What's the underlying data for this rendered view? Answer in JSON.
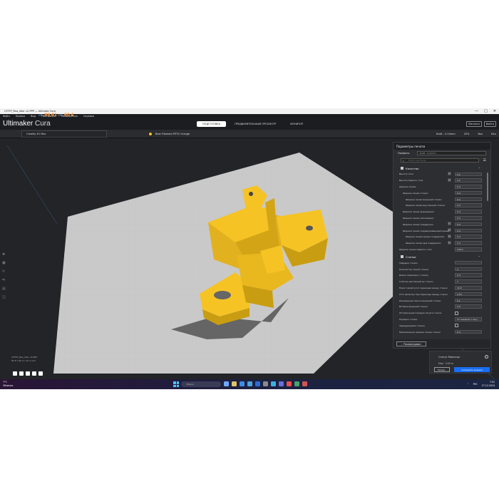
{
  "window": {
    "title": "CFFFP_Paw_Idler v2-PPP — Ultimate Cura",
    "controls": [
      "—",
      "□",
      "✕"
    ]
  },
  "menu": [
    "Файл",
    "Правка",
    "Вид",
    "Настройки",
    "Расширения",
    "Справка"
  ],
  "overlay_stats": {
    "label_a": "CPU",
    "val_a": "88",
    "sub_a": "41",
    "label_b": "GPU",
    "val_b": "60",
    "sub_b": "4"
  },
  "header": {
    "brand_bold": "Ultimaker",
    "brand_light": " Cura",
    "stage_tabs": [
      {
        "label": "ПОДГОТОВКА",
        "active": true
      },
      {
        "label": "ПРЕДВАРИТЕЛЬНЫЙ ПРОСМОТР",
        "active": false
      },
      {
        "label": "МОНИТОР",
        "active": false
      }
    ],
    "account_buttons": [
      "Магазин",
      "Войти"
    ]
  },
  "toolbar": {
    "printer": "Creality K1 Max",
    "material": "Best Filament PETG Orange",
    "profile_summary": "Draft - 0.24mm",
    "infill": "20%",
    "support": "Вкл",
    "adhesion": "Вкл"
  },
  "panel": {
    "title": "Параметры печати",
    "profile_label": "Профиль",
    "profile_value": "Draft - 0.24mm",
    "search_placeholder": "Поиск настроек",
    "category_quality": "Качество",
    "category_walls": "Стенки",
    "recommended_button": "Рекомендован",
    "quality_settings": [
      {
        "label": "Высота слоя",
        "value": "0.2",
        "indent": 0,
        "link": true
      },
      {
        "label": "Высота первого слоя",
        "value": "0.2",
        "indent": 0,
        "link": true
      },
      {
        "label": "Ширина линии",
        "value": "0.4",
        "indent": 0,
        "link": false
      },
      {
        "label": "Ширина линии стенки",
        "value": "0.4",
        "indent": 1,
        "link": false
      },
      {
        "label": "Ширина линии внешней стенки",
        "value": "0.4",
        "indent": 2,
        "link": false
      },
      {
        "label": "Ширина линии внутренней стенки",
        "value": "0.4",
        "indent": 2,
        "link": false
      },
      {
        "label": "Ширина линии дна/крышки",
        "value": "0.4",
        "indent": 1,
        "link": false
      },
      {
        "label": "Ширина линии заполнения",
        "value": "0.4",
        "indent": 1,
        "link": false
      },
      {
        "label": "Ширина линии поддержки",
        "value": "0.4",
        "indent": 1,
        "link": true
      },
      {
        "label": "Ширина линии поддерживающей крыши",
        "value": "0.4",
        "indent": 1,
        "link": true
      },
      {
        "label": "Ширина линии крыши поддержки",
        "value": "0.4",
        "indent": 2,
        "link": true
      },
      {
        "label": "Ширина линии дна поддержки",
        "value": "0.4",
        "indent": 2,
        "link": true
      },
      {
        "label": "Ширина линии первого слоя",
        "value": "100.0",
        "indent": 0,
        "link": false
      }
    ],
    "wall_settings": [
      {
        "label": "Твёрдые стенки",
        "value": "",
        "type": "text"
      },
      {
        "label": "Количество линий стенки",
        "value": "2",
        "type": "text"
      },
      {
        "label": "Длина перехода к стенке",
        "value": "0.4",
        "type": "text"
      },
      {
        "label": "Счётчик дистанций до стенок",
        "value": "1",
        "type": "text"
      },
      {
        "label": "Порог малой угол перехода между стенок",
        "value": "10.0",
        "type": "text"
      },
      {
        "label": "Угол фильтра при переходе между стенок",
        "value": "0.15",
        "type": "text"
      },
      {
        "label": "Расширение порога внешней стенки",
        "value": "0.1",
        "type": "text"
      },
      {
        "label": "Вставка внешней стенки",
        "value": "0.0",
        "type": "text"
      },
      {
        "label": "Оптимизация порядка печати стенок",
        "value": "",
        "type": "check"
      },
      {
        "label": "Порядок стенок",
        "value": "От внешних к вну...",
        "type": "select"
      },
      {
        "label": "Чередующаяся стенка",
        "value": "",
        "type": "check"
      },
      {
        "label": "Минимальная ширина линии стенки",
        "value": "0.3",
        "type": "text"
      }
    ]
  },
  "object_info": {
    "name": "CFFFP_Paw_Idler v2-PPP",
    "dims": "65.8 x 82.3 x 51.1 mm"
  },
  "slice_panel": {
    "title": "Статус Монитор",
    "status": "Мир · 0:00 m",
    "preview_button": "Предв...",
    "main_button": "Сохранить модель"
  },
  "taskbar": {
    "weather_temp": "7°C",
    "weather_desc": "Облачно",
    "search_placeholder": "Поиск",
    "lang": "РУС",
    "time": "7:52",
    "date": "27.12.2024"
  },
  "colors": {
    "model": "#f6c325",
    "accent": "#196ef0",
    "background": "#1e1f22"
  }
}
